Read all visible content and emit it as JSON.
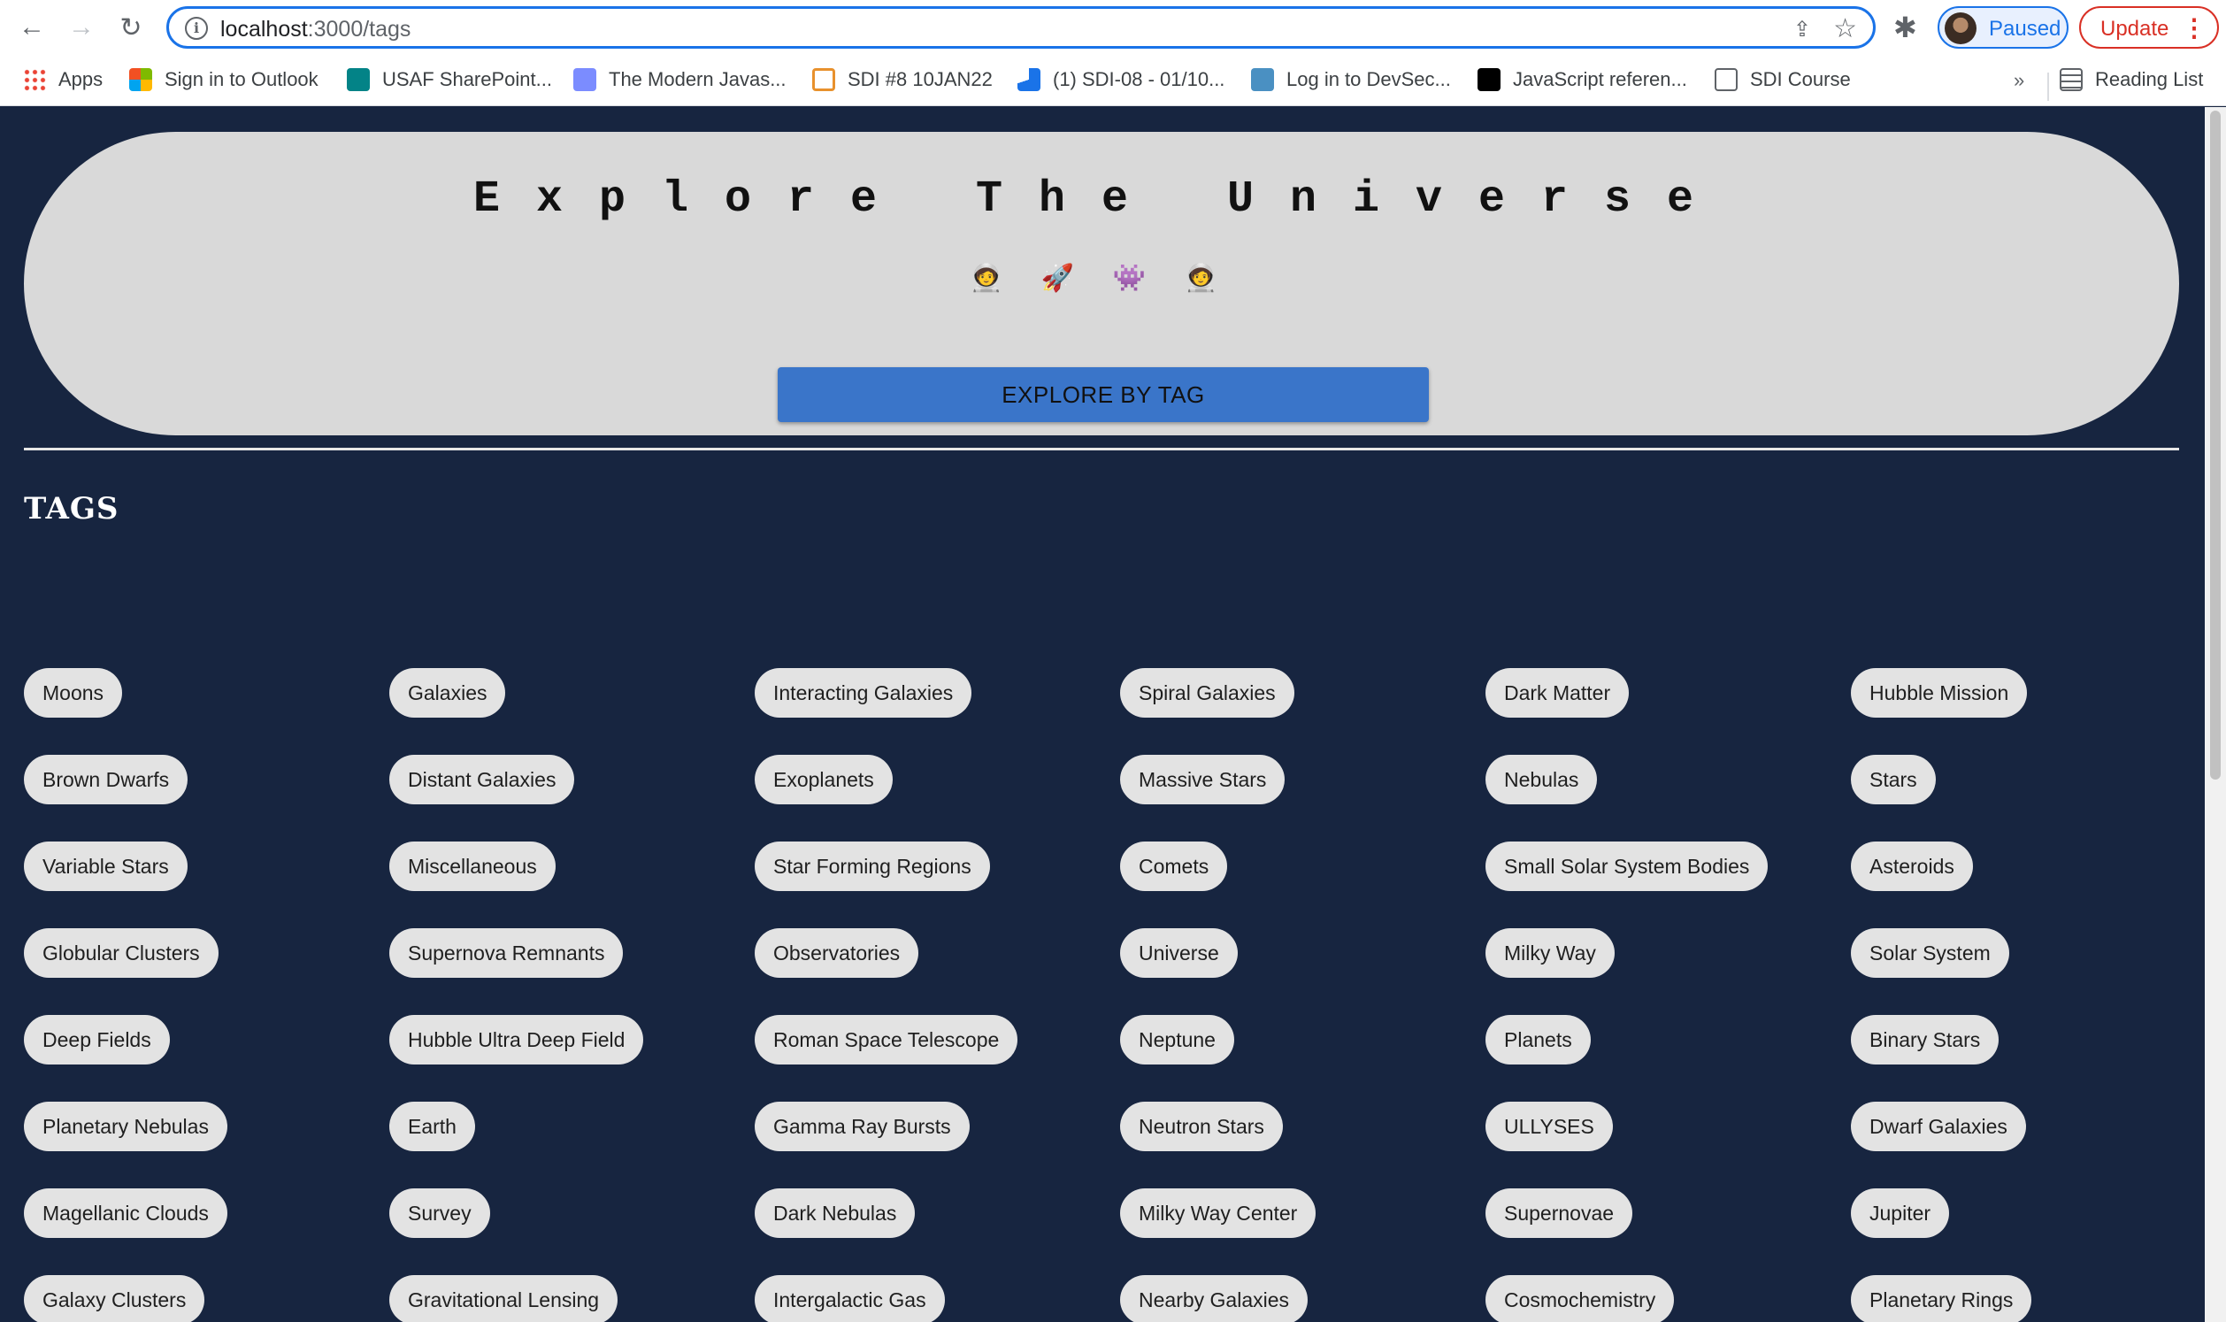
{
  "browser": {
    "url_host": "localhost",
    "url_path": ":3000/tags",
    "profile_label": "Paused",
    "update_label": "Update",
    "reading_list": "Reading List",
    "overflow": "»",
    "bookmarks": [
      {
        "label": "Apps",
        "icon": "apps-grid-icon"
      },
      {
        "label": "Sign in to Outlook",
        "icon": "microsoft-icon"
      },
      {
        "label": "USAF SharePoint...",
        "icon": "sharepoint-icon"
      },
      {
        "label": "The Modern Javas...",
        "icon": "javascript-info-icon"
      },
      {
        "label": "SDI #8 10JAN22",
        "icon": "sdi-icon"
      },
      {
        "label": "(1) SDI-08 - 01/10...",
        "icon": "meeting-icon"
      },
      {
        "label": "Log in to DevSec...",
        "icon": "devsec-icon"
      },
      {
        "label": "JavaScript referen...",
        "icon": "mdn-icon"
      },
      {
        "label": "SDI Course",
        "icon": "folder-icon"
      }
    ]
  },
  "hero": {
    "title": "Explore The Universe",
    "emojis": [
      "🧑‍🚀",
      "🚀",
      "👾",
      "🧑‍🚀"
    ],
    "button_label": "EXPLORE BY TAG"
  },
  "tags_section": {
    "title": "TAGS",
    "columns": [
      [
        "Moons",
        "Brown Dwarfs",
        "Variable Stars",
        "Globular Clusters",
        "Deep Fields",
        "Planetary Nebulas",
        "Magellanic Clouds",
        "Galaxy Clusters"
      ],
      [
        "Galaxies",
        "Distant Galaxies",
        "Miscellaneous",
        "Supernova Remnants",
        "Hubble Ultra Deep Field",
        "Earth",
        "Survey",
        "Gravitational Lensing"
      ],
      [
        "Interacting Galaxies",
        "Exoplanets",
        "Star Forming Regions",
        "Observatories",
        "Roman Space Telescope",
        "Gamma Ray Bursts",
        "Dark Nebulas",
        "Intergalactic Gas"
      ],
      [
        "Spiral Galaxies",
        "Massive Stars",
        "Comets",
        "Universe",
        "Neptune",
        "Neutron Stars",
        "Milky Way Center",
        "Nearby Galaxies"
      ],
      [
        "Dark Matter",
        "Nebulas",
        "Small Solar System Bodies",
        "Milky Way",
        "Planets",
        "ULLYSES",
        "Supernovae",
        "Cosmochemistry"
      ],
      [
        "Hubble Mission",
        "Stars",
        "Asteroids",
        "Solar System",
        "Binary Stars",
        "Dwarf Galaxies",
        "Jupiter",
        "Planetary Rings"
      ]
    ]
  },
  "colors": {
    "page_background": "#172540",
    "hero_background": "#d9d9d9",
    "button_blue": "#3a75c9",
    "chip_background": "#e3e3e3"
  }
}
